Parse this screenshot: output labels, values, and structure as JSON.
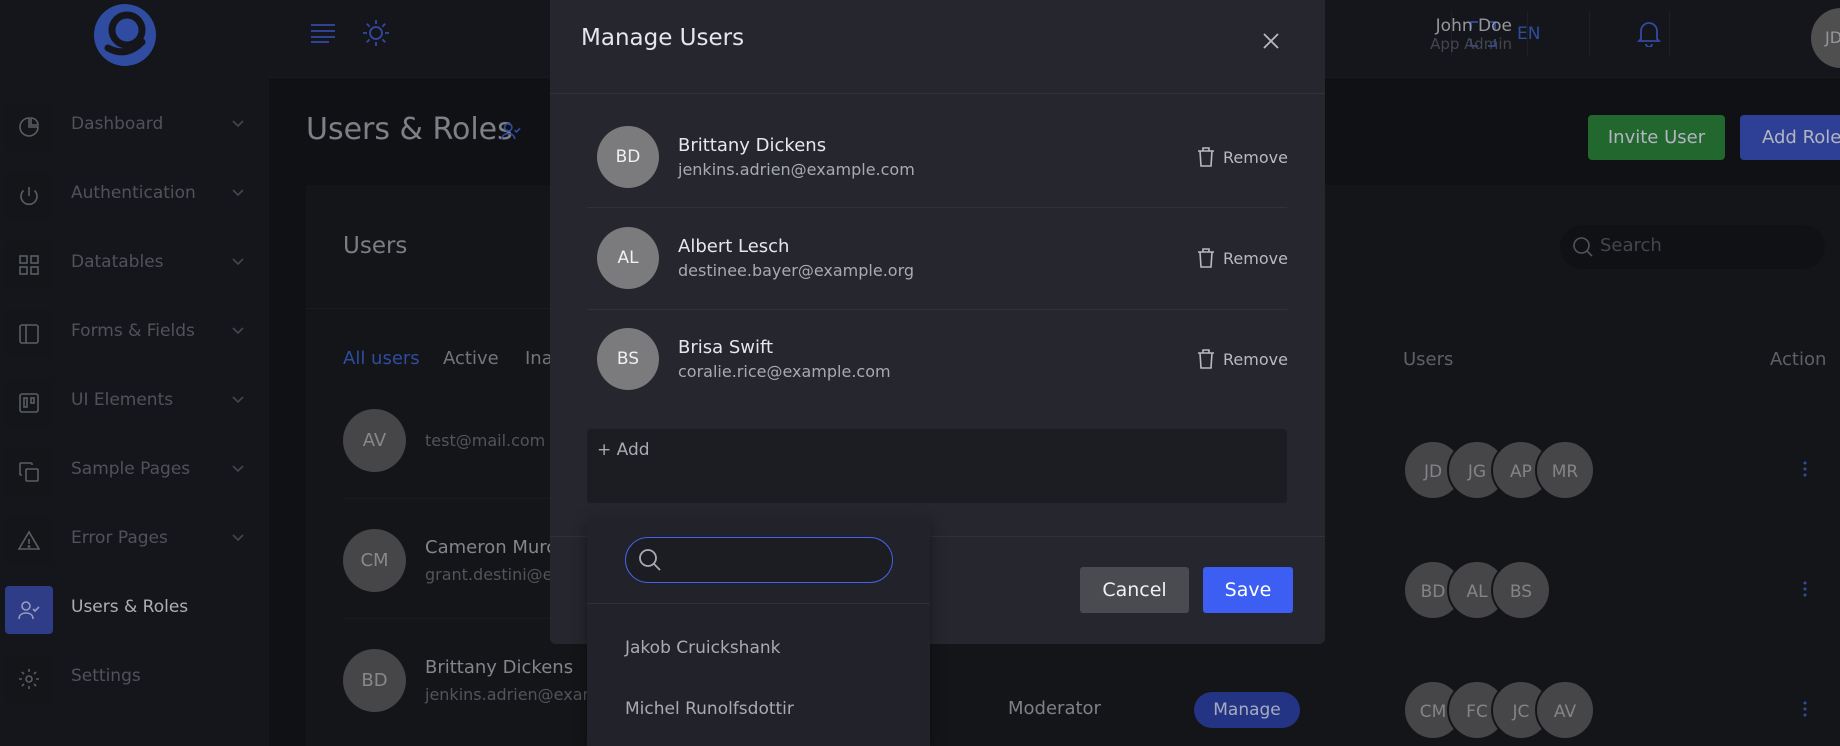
{
  "sidebar": {
    "items": [
      {
        "label": "Dashboard",
        "icon": "pie-chart-icon"
      },
      {
        "label": "Authentication",
        "icon": "power-icon"
      },
      {
        "label": "Datatables",
        "icon": "grid-icon"
      },
      {
        "label": "Forms & Fields",
        "icon": "sidebar-layout-icon"
      },
      {
        "label": "UI Elements",
        "icon": "kanban-icon"
      },
      {
        "label": "Sample Pages",
        "icon": "copy-icon"
      },
      {
        "label": "Error Pages",
        "icon": "alert-triangle-icon"
      },
      {
        "label": "Users & Roles",
        "icon": "user-check-icon"
      },
      {
        "label": "Settings",
        "icon": "gear-icon"
      }
    ]
  },
  "topbar": {
    "language": "EN",
    "user_name": "John Doe",
    "user_role": "App Admin",
    "avatar_initials": "JD"
  },
  "page": {
    "title": "Users & Roles",
    "invite_label": "Invite User",
    "add_role_label": "Add Role"
  },
  "users_card": {
    "title": "Users",
    "search_placeholder": "Search",
    "tabs": [
      "All users",
      "Active",
      "Ina"
    ],
    "rows": [
      {
        "initials": "AV",
        "name": "",
        "email": "test@mail.com"
      },
      {
        "initials": "CM",
        "name": "Cameron Murc",
        "email": "grant.destini@e"
      },
      {
        "initials": "BD",
        "name": "Brittany Dickens",
        "email": "jenkins.adrien@exam"
      }
    ]
  },
  "roles_table": {
    "col_users": "Users",
    "col_action": "Action",
    "rows": [
      {
        "role": "",
        "manage": "",
        "avatars": [
          "JD",
          "JG",
          "AP",
          "MR"
        ]
      },
      {
        "role": "",
        "manage": "",
        "avatars": [
          "BD",
          "AL",
          "BS"
        ]
      },
      {
        "role": "Moderator",
        "manage": "Manage",
        "avatars": [
          "CM",
          "FC",
          "JC",
          "AV"
        ]
      }
    ]
  },
  "modal": {
    "title": "Manage Users",
    "members": [
      {
        "initials": "BD",
        "name": "Brittany Dickens",
        "email": "jenkins.adrien@example.com"
      },
      {
        "initials": "AL",
        "name": "Albert Lesch",
        "email": "destinee.bayer@example.org"
      },
      {
        "initials": "BS",
        "name": "Brisa Swift",
        "email": "coralie.rice@example.com"
      }
    ],
    "remove_label": "Remove",
    "add_label": "+ Add",
    "cancel_label": "Cancel",
    "save_label": "Save"
  },
  "dropdown": {
    "search_value": "",
    "options": [
      "Jakob Cruickshank",
      "Michel Runolfsdottir"
    ]
  },
  "colors": {
    "accent": "#3f66d6",
    "primary_button": "#3d5ef2",
    "success_button": "#2e8b3e"
  }
}
